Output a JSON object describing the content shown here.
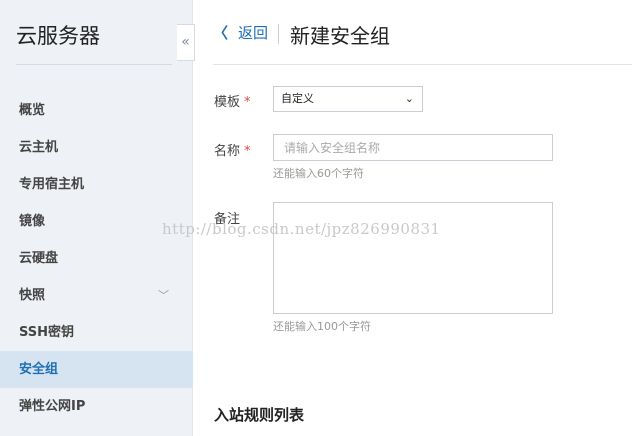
{
  "sidebar": {
    "title": "云服务器",
    "items": [
      {
        "label": "概览"
      },
      {
        "label": "云主机"
      },
      {
        "label": "专用宿主机"
      },
      {
        "label": "镜像"
      },
      {
        "label": "云硬盘"
      },
      {
        "label": "快照"
      },
      {
        "label": "SSH密钥"
      },
      {
        "label": "安全组"
      },
      {
        "label": "弹性公网IP"
      }
    ],
    "active_item": "安全组",
    "collapse_glyph": "«",
    "chevron_glyph": "﹀"
  },
  "header": {
    "back_arrow": "〈",
    "back_label": "返回",
    "title": "新建安全组"
  },
  "form": {
    "template": {
      "label": "模板",
      "required_mark": "*",
      "selected": "自定义",
      "arrow": "⌄"
    },
    "name": {
      "label": "名称",
      "required_mark": "*",
      "placeholder": "请输入安全组名称",
      "value": "",
      "hint": "还能输入60个字符"
    },
    "note": {
      "label": "备注",
      "value": "",
      "hint": "还能输入100个字符"
    }
  },
  "section": {
    "title": "入站规则列表"
  },
  "watermark": "http://blog.csdn.net/jpz826990831",
  "colors": {
    "accent": "#1f6fb5",
    "required": "#e04a3f",
    "sidebar_bg": "#eef1f5",
    "active_bg": "#d6e3f0"
  }
}
